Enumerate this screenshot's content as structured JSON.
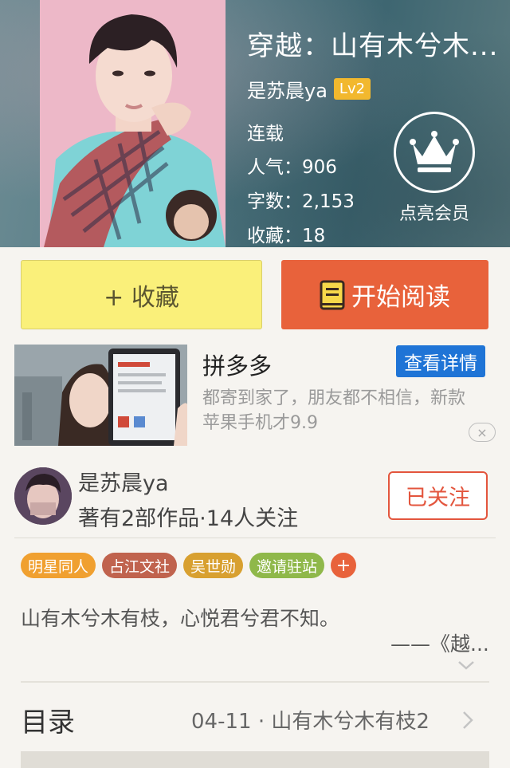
{
  "book": {
    "title": "穿越：山有木兮木...",
    "author": "是苏晨ya",
    "level": "Lv2",
    "status": "连载",
    "popularity": "人气：906",
    "word_count": "字数：2,153",
    "favorites": "收藏：18",
    "vip_label": "点亮会员"
  },
  "actions": {
    "collect_label": "+ 收藏",
    "read_label": "开始阅读"
  },
  "ad": {
    "title": "拼多多",
    "cta": "查看详情",
    "description": "都寄到家了，朋友都不相信，新款苹果手机才9.9",
    "close": "×"
  },
  "author_card": {
    "name": "是苏晨ya",
    "stats": "著有2部作品·14人关注",
    "follow_label": "已关注"
  },
  "tags": [
    {
      "label": "明星同人",
      "color": "#f0a030"
    },
    {
      "label": "占江文社",
      "color": "#c0634e"
    },
    {
      "label": "吴世勋",
      "color": "#d8a030"
    },
    {
      "label": "邀请驻站",
      "color": "#8fb84a"
    }
  ],
  "tag_add": "+",
  "intro": {
    "text": "山有木兮木有枝，心悦君兮君不知。",
    "source": "——《越..."
  },
  "toc": {
    "label": "目录",
    "latest": "04-11 · 山有木兮木有枝2"
  },
  "icons": {
    "crown": "crown-icon",
    "book": "book-icon",
    "close": "close-icon",
    "chevron_down": "chevron-down-icon",
    "chevron_right": "chevron-right-icon"
  },
  "colors": {
    "collect_bg": "#faf07a",
    "read_bg": "#e8623b",
    "follow_border": "#e3553d",
    "ad_cta_bg": "#1f74d6",
    "level_badge": "#f2b82e"
  }
}
